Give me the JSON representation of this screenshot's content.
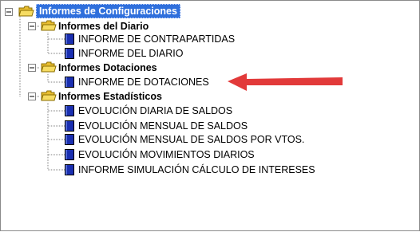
{
  "tree": {
    "root": {
      "label": "Informes de Configuraciones"
    },
    "groups": [
      {
        "label": "Informes del Diario",
        "items": [
          {
            "label": "INFORME DE CONTRAPARTIDAS"
          },
          {
            "label": "INFORME DEL DIARIO"
          }
        ]
      },
      {
        "label": "Informes Dotaciones",
        "items": [
          {
            "label": "INFORME DE DOTACIONES"
          }
        ]
      },
      {
        "label": "Informes Estadísticos",
        "items": [
          {
            "label": "EVOLUCIÓN DIARIA DE SALDOS"
          },
          {
            "label": "EVOLUCIÓN MENSUAL DE SALDOS"
          },
          {
            "label": "EVOLUCIÓN MENSUAL DE SALDOS POR VTOS."
          },
          {
            "label": "EVOLUCIÓN MOVIMIENTOS DIARIOS"
          },
          {
            "label": "INFORME SIMULACIÓN CÁLCULO DE INTERESES"
          }
        ]
      }
    ]
  },
  "colors": {
    "selection": "#2f6fdc",
    "folder": "#f2d24b",
    "doc": "#1a2fb0",
    "arrow": "#e23a3a"
  },
  "icons": {
    "expander": "minus-box-icon",
    "folder": "open-folder-icon",
    "document": "report-document-icon",
    "annotation": "red-arrow-icon"
  }
}
